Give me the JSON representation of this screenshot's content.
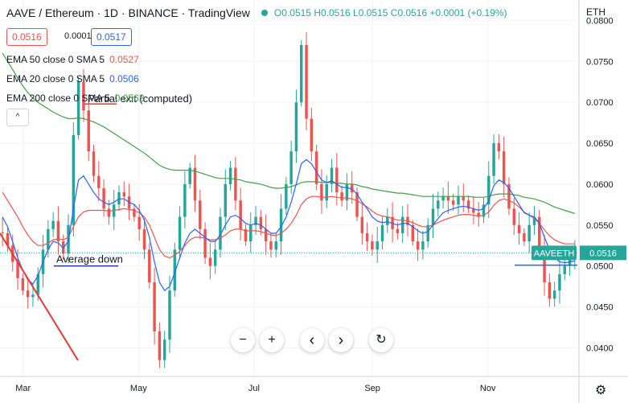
{
  "header": {
    "title": "AAVE / Ethereum · 1D · BINANCE · TradingView",
    "ohlc": {
      "o_label": "O",
      "o": "0.0515",
      "h_label": "H",
      "h": "0.0516",
      "l_label": "L",
      "l": "0.0515",
      "c_label": "C",
      "c": "0.0516",
      "change": "+0.0001 (+0.19%)"
    },
    "bid": "0.0516",
    "spread": "0.0001",
    "ask": "0.0517",
    "currency": "ETH"
  },
  "indicators": [
    {
      "label": "EMA 50 close 0 SMA 5",
      "value": "0.0527",
      "color": "#ef5350"
    },
    {
      "label": "EMA 20 close 0 SMA 5",
      "value": "0.0506",
      "color": "#2962ff"
    },
    {
      "label": "EMA 200 close 0 SMA 5",
      "value": "0.0562",
      "color": "#43a047"
    }
  ],
  "colors": {
    "up": "#26a69a",
    "down": "#ef5350",
    "ema50": "#ef5350",
    "ema20": "#2962ff",
    "ema200": "#43a047",
    "annotation_red": "#e53935",
    "annotation_blue": "#1e3a8a",
    "grid": "#f0f3fa",
    "price_tag": "#26a69a"
  },
  "navigation": {
    "zoom_out": "−",
    "zoom_in": "+",
    "back": "‹",
    "forward": "›",
    "reset": "↻",
    "collapse": "^",
    "settings": "⚙"
  },
  "chart_data": {
    "type": "candlestick",
    "y_axis": {
      "ticks": [
        "0.0800",
        "0.0750",
        "0.0700",
        "0.0650",
        "0.0600",
        "0.0550",
        "0.0500",
        "0.0450",
        "0.0400"
      ],
      "ylim": [
        0.0365,
        0.0825
      ],
      "position": "right"
    },
    "x_axis": {
      "ticks": [
        "Mar",
        "May",
        "Jul",
        "Sep",
        "Nov"
      ]
    },
    "grid": true,
    "last_price": {
      "symbol": "AAVEETH",
      "value": "0.0516"
    },
    "current_price_line": 0.0516,
    "annotations": [
      {
        "text": "Partial exit (computed)",
        "price": 0.0698
      },
      {
        "text": "Average down",
        "price": 0.05
      }
    ],
    "series": [
      {
        "name": "AAVEETH",
        "type": "candles",
        "close_path": [
          0.054,
          0.0525,
          0.0505,
          0.0485,
          0.047,
          0.0462,
          0.0465,
          0.049,
          0.052,
          0.0545,
          0.0555,
          0.053,
          0.0515,
          0.055,
          0.066,
          0.0725,
          0.069,
          0.064,
          0.061,
          0.0595,
          0.057,
          0.056,
          0.0575,
          0.059,
          0.0585,
          0.057,
          0.056,
          0.0545,
          0.052,
          0.048,
          0.042,
          0.0385,
          0.041,
          0.047,
          0.052,
          0.056,
          0.06,
          0.062,
          0.058,
          0.0545,
          0.051,
          0.05,
          0.052,
          0.056,
          0.06,
          0.062,
          0.058,
          0.0545,
          0.053,
          0.055,
          0.056,
          0.0545,
          0.053,
          0.052,
          0.053,
          0.057,
          0.06,
          0.064,
          0.07,
          0.077,
          0.068,
          0.064,
          0.06,
          0.058,
          0.06,
          0.062,
          0.059,
          0.058,
          0.06,
          0.059,
          0.056,
          0.054,
          0.053,
          0.052,
          0.053,
          0.055,
          0.056,
          0.0545,
          0.054,
          0.056,
          0.055,
          0.053,
          0.052,
          0.053,
          0.055,
          0.057,
          0.058,
          0.0585,
          0.058,
          0.0575,
          0.0585,
          0.058,
          0.057,
          0.0565,
          0.056,
          0.0575,
          0.061,
          0.065,
          0.064,
          0.06,
          0.057,
          0.055,
          0.054,
          0.053,
          0.055,
          0.056,
          0.052,
          0.048,
          0.046,
          0.047,
          0.049,
          0.05,
          0.051,
          0.0516
        ],
        "ema20_path": [
          0.056,
          0.0548,
          0.053,
          0.051,
          0.0495,
          0.0483,
          0.0478,
          0.0488,
          0.0505,
          0.052,
          0.053,
          0.0528,
          0.0522,
          0.053,
          0.057,
          0.0605,
          0.061,
          0.06,
          0.059,
          0.0582,
          0.0578,
          0.0575,
          0.0578,
          0.0582,
          0.0582,
          0.0578,
          0.0575,
          0.0568,
          0.0556,
          0.0535,
          0.0505,
          0.048,
          0.047,
          0.0475,
          0.0492,
          0.051,
          0.0528,
          0.054,
          0.0545,
          0.054,
          0.0535,
          0.053,
          0.053,
          0.0538,
          0.055,
          0.056,
          0.0562,
          0.0558,
          0.0552,
          0.055,
          0.0552,
          0.055,
          0.0545,
          0.054,
          0.054,
          0.0548,
          0.056,
          0.0578,
          0.06,
          0.0625,
          0.063,
          0.0625,
          0.0615,
          0.0605,
          0.0602,
          0.0604,
          0.06,
          0.0596,
          0.0596,
          0.0594,
          0.0588,
          0.0578,
          0.057,
          0.056,
          0.0555,
          0.0553,
          0.0554,
          0.0552,
          0.055,
          0.0552,
          0.0552,
          0.0548,
          0.0543,
          0.054,
          0.0542,
          0.055,
          0.0558,
          0.0565,
          0.0568,
          0.057,
          0.0572,
          0.0573,
          0.0572,
          0.057,
          0.0568,
          0.057,
          0.058,
          0.0598,
          0.0605,
          0.0602,
          0.0595,
          0.0585,
          0.0575,
          0.0565,
          0.0562,
          0.056,
          0.0552,
          0.0535,
          0.052,
          0.051,
          0.0505,
          0.0504,
          0.0505,
          0.0506
        ],
        "ema50_path": [
          0.059,
          0.058,
          0.057,
          0.056,
          0.0548,
          0.0538,
          0.053,
          0.0525,
          0.0525,
          0.0528,
          0.0532,
          0.0533,
          0.0532,
          0.0535,
          0.0548,
          0.056,
          0.0566,
          0.0568,
          0.0568,
          0.0568,
          0.0568,
          0.0567,
          0.0568,
          0.0569,
          0.057,
          0.0569,
          0.0568,
          0.0565,
          0.056,
          0.055,
          0.0535,
          0.052,
          0.0512,
          0.051,
          0.0513,
          0.0518,
          0.0525,
          0.0532,
          0.0535,
          0.0535,
          0.0534,
          0.0532,
          0.0532,
          0.0534,
          0.0538,
          0.0543,
          0.0545,
          0.0545,
          0.0543,
          0.0543,
          0.0543,
          0.0542,
          0.054,
          0.0538,
          0.0537,
          0.054,
          0.0545,
          0.0552,
          0.0562,
          0.0575,
          0.0582,
          0.0585,
          0.0585,
          0.0584,
          0.0584,
          0.0585,
          0.0584,
          0.0583,
          0.0583,
          0.0582,
          0.058,
          0.0576,
          0.0572,
          0.0567,
          0.0563,
          0.0561,
          0.056,
          0.0558,
          0.0556,
          0.0556,
          0.0555,
          0.0553,
          0.055,
          0.0548,
          0.0548,
          0.055,
          0.0553,
          0.0556,
          0.0558,
          0.056,
          0.0562,
          0.0563,
          0.0563,
          0.0562,
          0.0561,
          0.0562,
          0.0566,
          0.0574,
          0.058,
          0.0582,
          0.058,
          0.0577,
          0.0572,
          0.0566,
          0.0562,
          0.0558,
          0.0552,
          0.0544,
          0.0537,
          0.0532,
          0.0529,
          0.0527,
          0.0527,
          0.0527
        ],
        "ema200_path": [
          0.076,
          0.075,
          0.074,
          0.073,
          0.072,
          0.0712,
          0.0705,
          0.07,
          0.0696,
          0.0692,
          0.0688,
          0.0685,
          0.0682,
          0.068,
          0.068,
          0.0681,
          0.068,
          0.0678,
          0.0676,
          0.0673,
          0.067,
          0.0666,
          0.0662,
          0.0658,
          0.0654,
          0.065,
          0.0646,
          0.0642,
          0.0638,
          0.0633,
          0.0628,
          0.0623,
          0.062,
          0.0618,
          0.0617,
          0.0617,
          0.0617,
          0.0617,
          0.0616,
          0.0614,
          0.0612,
          0.061,
          0.0608,
          0.0607,
          0.0607,
          0.0607,
          0.0606,
          0.0605,
          0.0603,
          0.0602,
          0.0601,
          0.06,
          0.0598,
          0.0596,
          0.0595,
          0.0595,
          0.0596,
          0.0597,
          0.0599,
          0.0602,
          0.0603,
          0.0603,
          0.0603,
          0.0602,
          0.0602,
          0.0602,
          0.0601,
          0.0601,
          0.06,
          0.06,
          0.0599,
          0.0597,
          0.0596,
          0.0594,
          0.0593,
          0.0592,
          0.0591,
          0.059,
          0.0589,
          0.0589,
          0.0588,
          0.0587,
          0.0586,
          0.0585,
          0.0585,
          0.0585,
          0.0585,
          0.0585,
          0.0585,
          0.0585,
          0.0585,
          0.0585,
          0.0585,
          0.0584,
          0.0584,
          0.0584,
          0.0585,
          0.0587,
          0.0588,
          0.0588,
          0.0588,
          0.0587,
          0.0586,
          0.0584,
          0.0583,
          0.0582,
          0.058,
          0.0578,
          0.0575,
          0.0572,
          0.057,
          0.0568,
          0.0566,
          0.0564
        ]
      }
    ]
  }
}
